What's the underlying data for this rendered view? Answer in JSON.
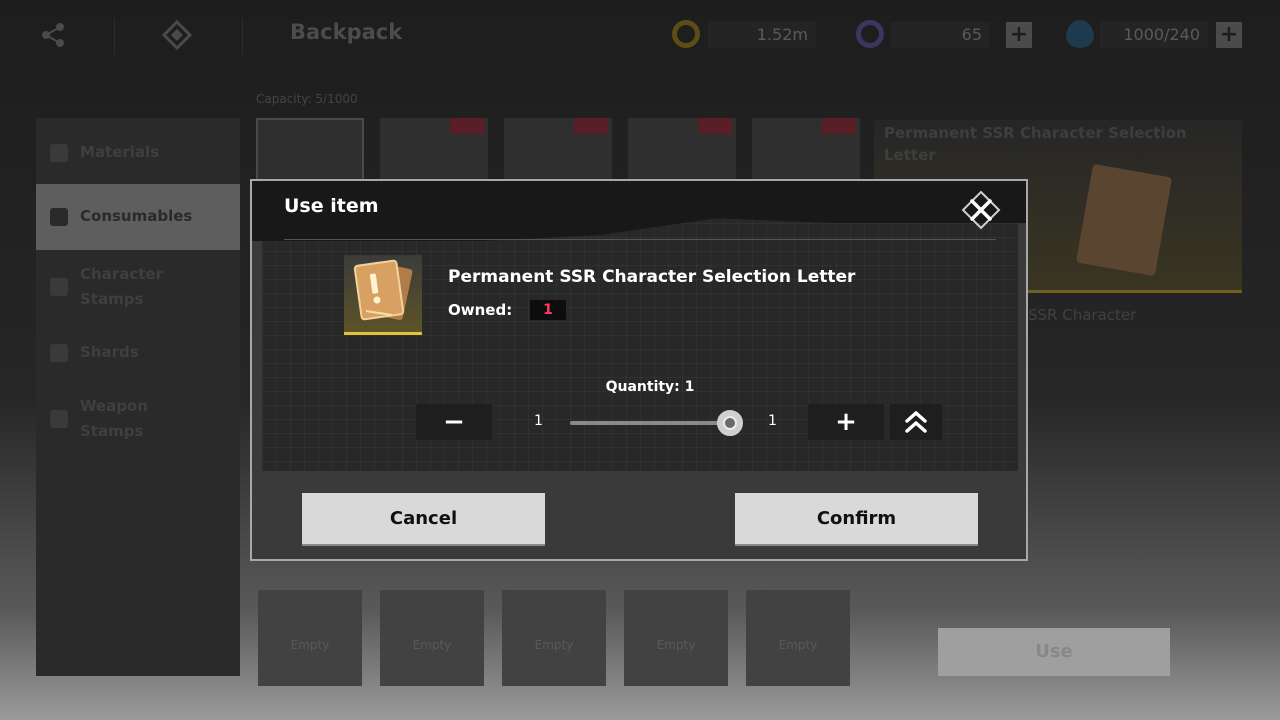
{
  "topbar": {
    "title": "Backpack",
    "gold": "1.52m",
    "gems": "65",
    "energy": "1000/240",
    "share_icon": "share-icon",
    "menu_icon": "diamond-menu-icon"
  },
  "inventory": {
    "capacity": "Capacity: 5/1000",
    "empty_label": "Empty"
  },
  "sidebar": {
    "items": [
      {
        "label": "Materials"
      },
      {
        "label": "Consumables"
      },
      {
        "label": "Character Stamps"
      },
      {
        "label": "Shards"
      },
      {
        "label": "Weapon Stamps"
      }
    ]
  },
  "detail": {
    "title": "Permanent SSR Character Selection Letter",
    "subtitle": "SSR Character",
    "use_label": "Use"
  },
  "modal": {
    "title": "Use item",
    "item_name": "Permanent SSR Character Selection Letter",
    "owned_label": "Owned:",
    "owned_value": "1",
    "quantity_label": "Quantity: 1",
    "min_value": "1",
    "max_value": "1",
    "slider_fraction": 1,
    "minus_symbol": "−",
    "plus_symbol": "+",
    "cancel_label": "Cancel",
    "confirm_label": "Confirm"
  },
  "colors": {
    "owned_value": "#ff3a63",
    "rarity_gold": "#e3c23c",
    "new_badge": "#5a1e26"
  }
}
